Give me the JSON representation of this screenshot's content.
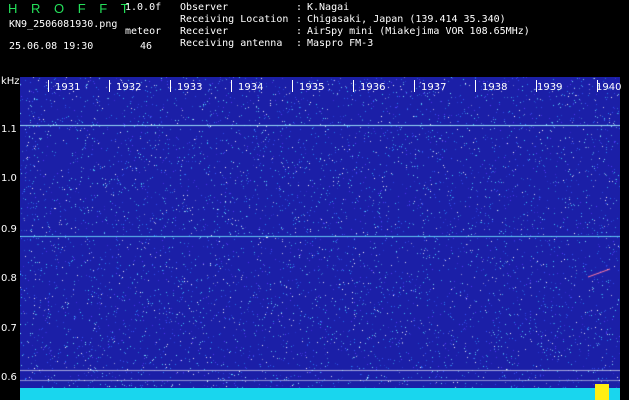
{
  "header": {
    "app_title": "H R O F F T",
    "version": "1.0.0f",
    "filename": "KN9_2506081930.png",
    "mode": "meteor",
    "timestamp": "25.06.08 19:30",
    "count": "46"
  },
  "metadata": [
    {
      "label": "Observer",
      "value": "K.Nagai"
    },
    {
      "label": "Receiving Location",
      "value": "Chigasaki, Japan (139.414 35.340)"
    },
    {
      "label": "Receiver",
      "value": "AirSpy mini (Miakejima VOR 108.65MHz)"
    },
    {
      "label": "Receiving antenna",
      "value": "Maspro FM-3"
    }
  ],
  "spectrogram": {
    "y_unit": "kHz",
    "y_ticks": [
      "1.1",
      "1.0",
      "0.9",
      "0.8",
      "0.7",
      "0.6"
    ],
    "x_ticks": [
      "1931",
      "1932",
      "1933",
      "1934",
      "1935",
      "1936",
      "1937",
      "1938",
      "1939",
      "1940"
    ],
    "colors": {
      "background": "#1b1fa7",
      "noise": "#7fe8ff",
      "band": "#19d6ee",
      "marker": "#ffee12"
    }
  }
}
